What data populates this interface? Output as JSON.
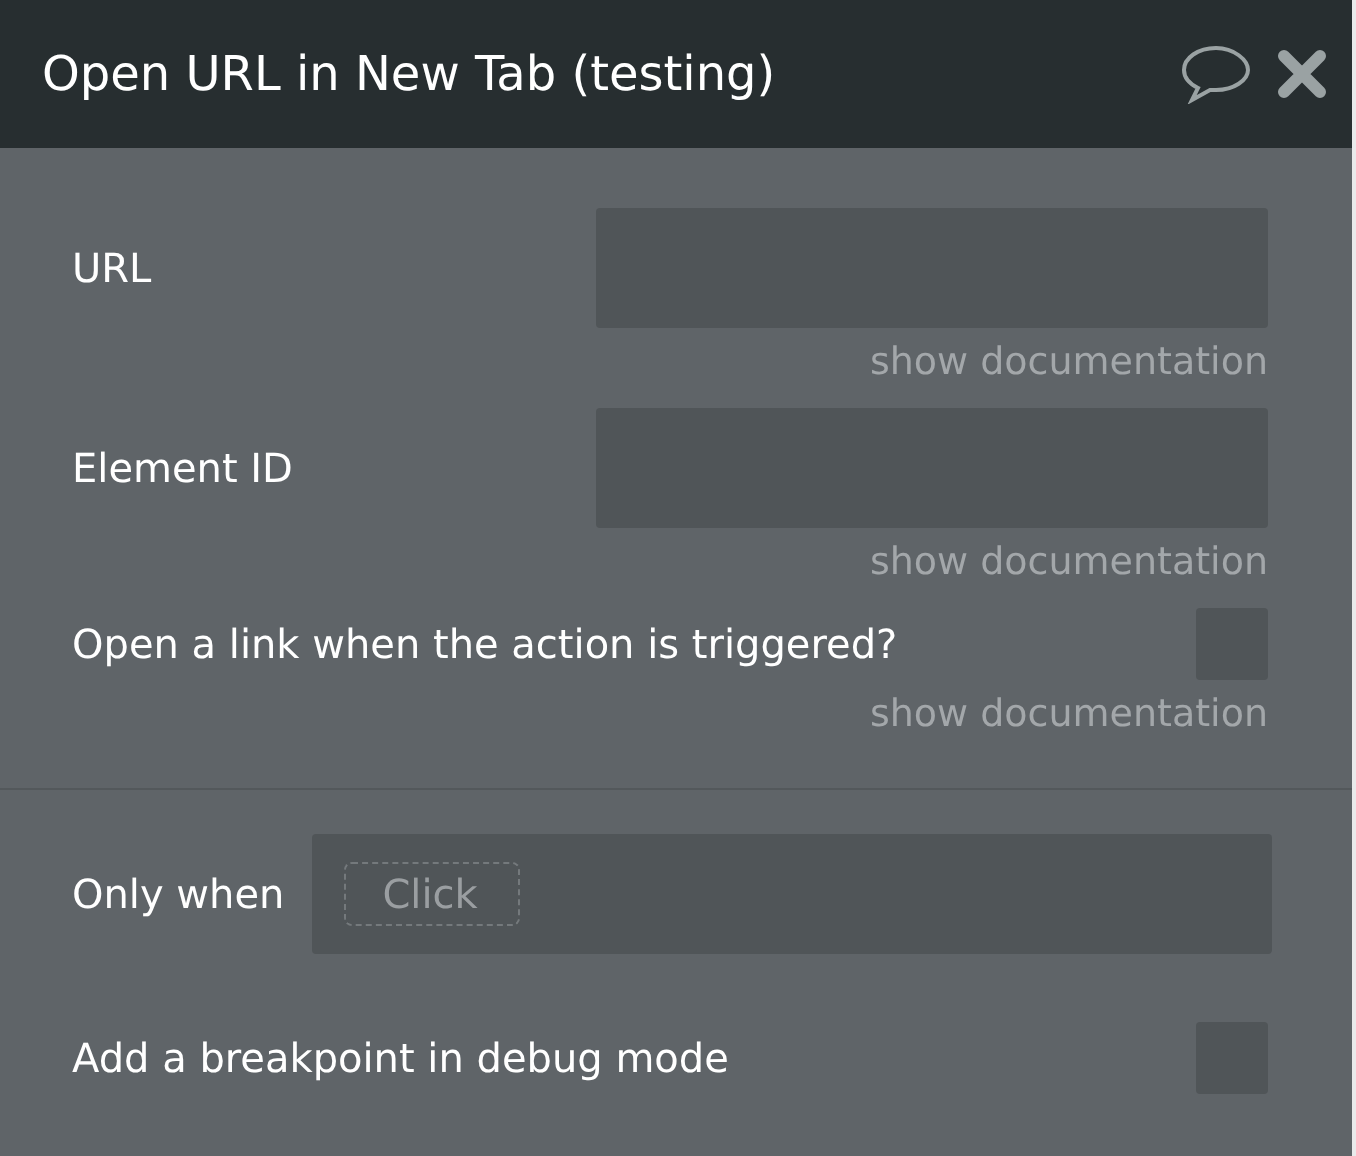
{
  "header": {
    "title": "Open URL in New Tab (testing)"
  },
  "fields": [
    {
      "kind": "text",
      "label": "URL",
      "doc_link": "show documentation"
    },
    {
      "kind": "text",
      "label": "Element ID",
      "doc_link": "show documentation"
    },
    {
      "kind": "checkbox",
      "label": "Open a link when the action is triggered?",
      "checked": false,
      "doc_link": "show documentation"
    }
  ],
  "condition": {
    "label": "Only when",
    "placeholder": "Click"
  },
  "breakpoint": {
    "label": "Add a breakpoint in debug mode",
    "checked": false
  }
}
